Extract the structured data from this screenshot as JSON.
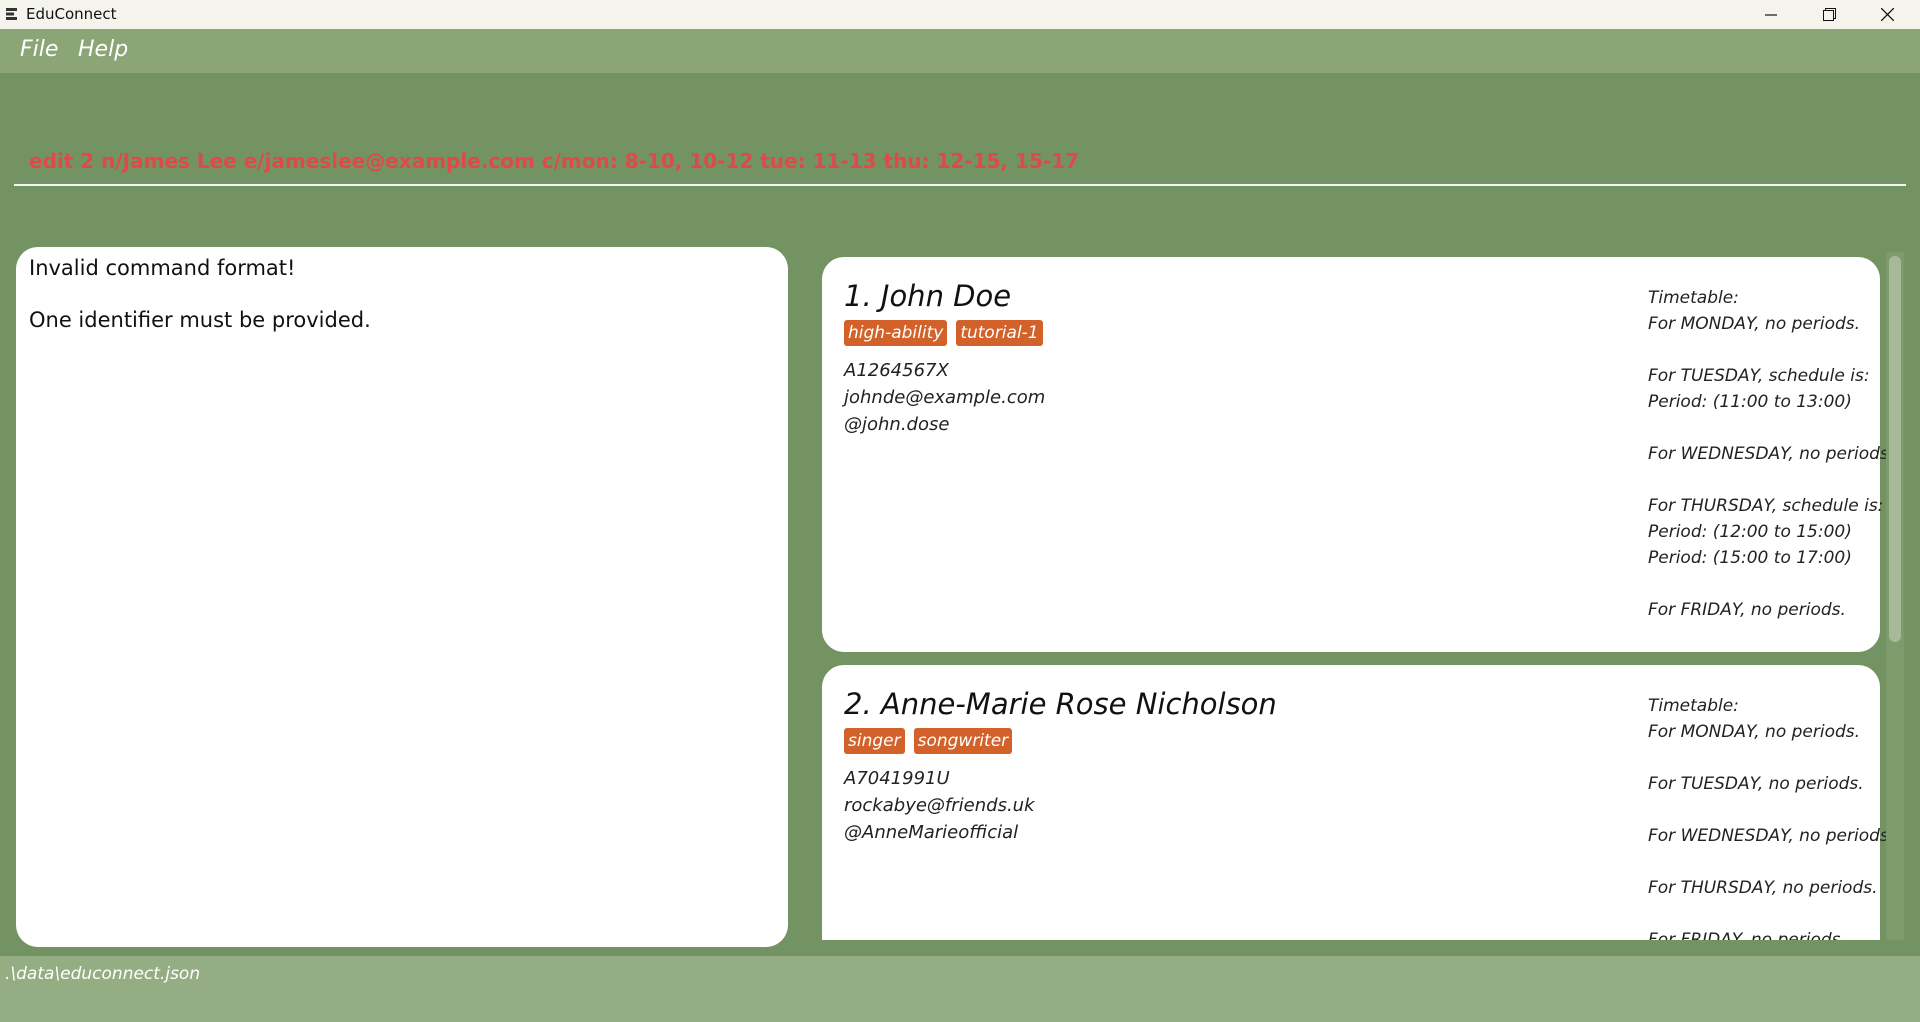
{
  "window": {
    "title": "EduConnect",
    "icons": {
      "app": "app-logo-icon",
      "minimize": "minimize-icon",
      "maximize": "maximize-icon",
      "close": "close-icon"
    }
  },
  "menu": {
    "file": "File",
    "help": "Help"
  },
  "command": {
    "value": "edit 2 n/James Lee e/jameslee@example.com c/mon: 8-10, 10-12 tue: 11-13 thu: 12-15, 15-17"
  },
  "result": {
    "line1": "Invalid command format!",
    "line2": "One identifier must be provided."
  },
  "persons": [
    {
      "index": "1.",
      "name": "John Doe",
      "tags": [
        "high-ability",
        "tutorial-1"
      ],
      "student_id": "A1264567X",
      "email": "johnde@example.com",
      "telegram": "@john.dose",
      "timetable_label": "Timetable:",
      "timetable": [
        "For MONDAY, no periods.",
        "",
        "For TUESDAY, schedule is:",
        "Period: (11:00 to 13:00)",
        "",
        "For WEDNESDAY, no periods.",
        "",
        "For THURSDAY, schedule is:",
        "Period: (12:00 to 15:00)",
        "Period: (15:00 to 17:00)",
        "",
        "For FRIDAY, no periods."
      ]
    },
    {
      "index": "2.",
      "name": "Anne-Marie Rose Nicholson",
      "tags": [
        "singer",
        "songwriter"
      ],
      "student_id": "A7041991U",
      "email": "rockabye@friends.uk",
      "telegram": "@AnneMarieofficial",
      "timetable_label": "Timetable:",
      "timetable": [
        "For MONDAY, no periods.",
        "",
        "For TUESDAY, no periods.",
        "",
        "For WEDNESDAY, no periods.",
        "",
        "For THURSDAY, no periods.",
        "",
        "For FRIDAY, no periods."
      ]
    }
  ],
  "status": {
    "path": ".\\data\\educonnect.json"
  },
  "colors": {
    "tag": "#d3622a",
    "command_text": "#e0494a",
    "background": "#739462",
    "menubar": "#8ba577"
  }
}
